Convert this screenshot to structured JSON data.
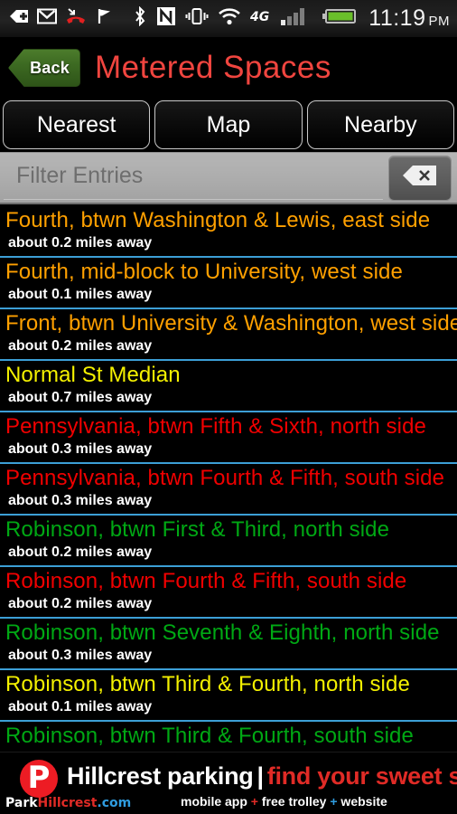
{
  "statusbar": {
    "icons": [
      "download-arrow-icon",
      "gmail-icon",
      "missed-call-icon",
      "flag-icon",
      "bluetooth-icon",
      "nfc-icon",
      "vibrate-icon",
      "wifi-icon",
      "network-4g-icon",
      "signal-bars-icon",
      "battery-icon"
    ],
    "network_label": "4G",
    "time": "11:19",
    "ampm": "PM"
  },
  "titlebar": {
    "back_label": "Back",
    "title": "Metered Spaces",
    "title_color": "#f0453f",
    "back_color": "#3d6a22"
  },
  "tabs": [
    {
      "label": "Nearest"
    },
    {
      "label": "Map"
    },
    {
      "label": "Nearby"
    }
  ],
  "filter": {
    "placeholder": "Filter Entries",
    "value": "",
    "clear_icon": "backspace-clear-icon"
  },
  "list": {
    "divider_color": "#3c9fd6",
    "items": [
      {
        "title": "Fourth, btwn Washington & Lewis, east side",
        "distance": "about 0.2 miles away",
        "color": "#ffa000"
      },
      {
        "title": "Fourth, mid-block to University, west side",
        "distance": "about 0.1 miles away",
        "color": "#ffa000"
      },
      {
        "title": "Front, btwn University & Washington, west side",
        "distance": "about 0.2 miles away",
        "color": "#ffa000"
      },
      {
        "title": "Normal St Median",
        "distance": "about 0.7 miles away",
        "color": "#f4f100"
      },
      {
        "title": "Pennsylvania, btwn Fifth & Sixth, north side",
        "distance": "about 0.3 miles away",
        "color": "#f00000"
      },
      {
        "title": "Pennsylvania, btwn Fourth & Fifth, south side",
        "distance": "about 0.3 miles away",
        "color": "#f00000"
      },
      {
        "title": "Robinson, btwn First & Third, north side",
        "distance": "about 0.2 miles away",
        "color": "#00a814"
      },
      {
        "title": "Robinson, btwn Fourth & Fifth, south side",
        "distance": "about 0.2 miles away",
        "color": "#f00000"
      },
      {
        "title": "Robinson, btwn Seventh & Eighth, north side",
        "distance": "about 0.3 miles away",
        "color": "#00a814"
      },
      {
        "title": "Robinson, btwn Third & Fourth, north side",
        "distance": "about 0.1 miles away",
        "color": "#f4f100"
      },
      {
        "title": "Robinson, btwn Third & Fourth, south side",
        "distance": "",
        "color": "#00a814"
      }
    ]
  },
  "ad": {
    "logo_letter": "P",
    "headline_white": "Hillcrest parking",
    "headline_bar": "|",
    "headline_red": "find your sweet spot.",
    "headline_mark": "▼",
    "sub_1": "mobile app ",
    "sub_plus1": "+",
    "sub_2": " free trolley ",
    "sub_plus2": "+",
    "sub_3": " website",
    "url_1": "Park",
    "url_2": "Hillcrest",
    "url_3": ".com"
  }
}
